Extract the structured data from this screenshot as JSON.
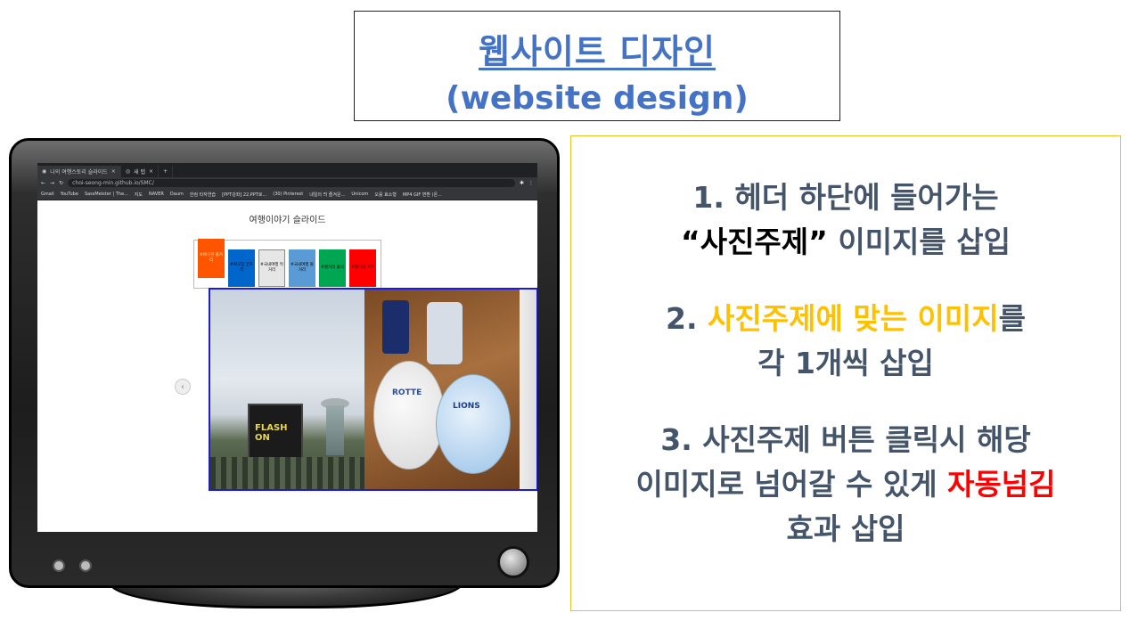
{
  "title": {
    "line1": "웹사이트 디자인",
    "line2": "(website design)"
  },
  "browser": {
    "tabs": [
      {
        "label": "나의 여행스토리 슬라이드"
      },
      {
        "label": "새 탭"
      }
    ],
    "url": "choi-seong-min.github.io/SMC/",
    "bookmarks": [
      "Gmail",
      "YouTube",
      "SassMeister | The...",
      "지도",
      "NAVER",
      "Daum",
      "한컴 타자연습",
      "[PPT강좌] 22.PPT로...",
      "(30) Pinterest",
      "내일의 띄 즐겨운...",
      "Unicom",
      "오를 효소형",
      "MP4 GIF 변환 (온..."
    ],
    "page": {
      "slide_title": "여행이야기 슬라이드",
      "theme_buttons": [
        {
          "label": "#야구관 즐겨리",
          "color": "#ff5500"
        },
        {
          "label": "#야구장 굿즈리",
          "color": "#0066cc"
        },
        {
          "label": "#국내여행 먹거리",
          "color": "#e6e6e6"
        },
        {
          "label": "#국내여행 볼거리",
          "color": "#5b9bd5"
        },
        {
          "label": "#명거리 즐식",
          "color": "#00a651"
        },
        {
          "label": "#명거리 굿즈",
          "color": "#ff0000"
        }
      ],
      "photos": {
        "stadium_screen": "FLASH ON",
        "ball1": "ROTTE",
        "ball2": "LIONS"
      }
    }
  },
  "info": {
    "item1": {
      "line1": "1. 헤더 하단에 들어가는",
      "quote": "“사진주제”",
      "line2_rest": " 이미지를 삽입"
    },
    "item2": {
      "num": "2. ",
      "hl1": "사진주제에 맞는",
      "sp": " ",
      "hl2": "이미지",
      "tail": "를",
      "line2": "각 1개씩 삽입"
    },
    "item3": {
      "line1": "3. 사진주제 버튼 클릭시 해당",
      "line2_pre": "이미지로 넘어갈 수 있게 ",
      "line2_hl": "자동넘김",
      "line3": "효과 삽입"
    }
  },
  "colors": {
    "title": "#4472c4",
    "info_text": "#44546a",
    "gold": "#ffc000",
    "red": "#ff0000",
    "panel_border": "#f0c020"
  }
}
